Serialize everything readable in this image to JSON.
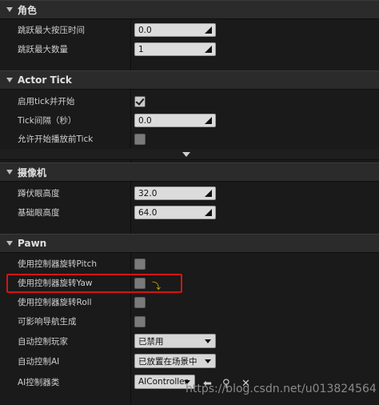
{
  "sections": {
    "character": {
      "title": "角色",
      "rows": [
        {
          "label": "跳跃最大按压时间",
          "value": "0.0"
        },
        {
          "label": "跳跃最大数量",
          "value": "1"
        }
      ]
    },
    "actor_tick": {
      "title": "Actor Tick",
      "rows": [
        {
          "label": "启用tick并开始",
          "checked": true
        },
        {
          "label": "Tick间隔（秒）",
          "value": "0.0"
        },
        {
          "label": "允许开始播放前Tick",
          "checked": false
        }
      ]
    },
    "camera": {
      "title": "摄像机",
      "rows": [
        {
          "label": "蹲伏眼高度",
          "value": "32.0"
        },
        {
          "label": "基础眼高度",
          "value": "64.0"
        }
      ]
    },
    "pawn": {
      "title": "Pawn",
      "rows": [
        {
          "label": "使用控制器旋转Pitch",
          "checked": false
        },
        {
          "label": "使用控制器旋转Yaw",
          "checked": false
        },
        {
          "label": "使用控制器旋转Roll",
          "checked": false
        },
        {
          "label": "可影响导航生成",
          "checked": false
        },
        {
          "label": "自动控制玩家",
          "value": "已禁用"
        },
        {
          "label": "自动控制AI",
          "value": "已放置在场景中"
        },
        {
          "label": "AI控制器类",
          "value": "AIController"
        }
      ]
    }
  },
  "watermark": "https://blog.csdn.net/u013824564",
  "colors": {
    "highlight_box": "#d41414",
    "reset_arrow": "#d6b400"
  },
  "icons": {
    "reset": "reset-to-default-icon",
    "use_asset": "arrow-left-icon",
    "browse": "magnifier-icon",
    "clear": "close-icon"
  }
}
